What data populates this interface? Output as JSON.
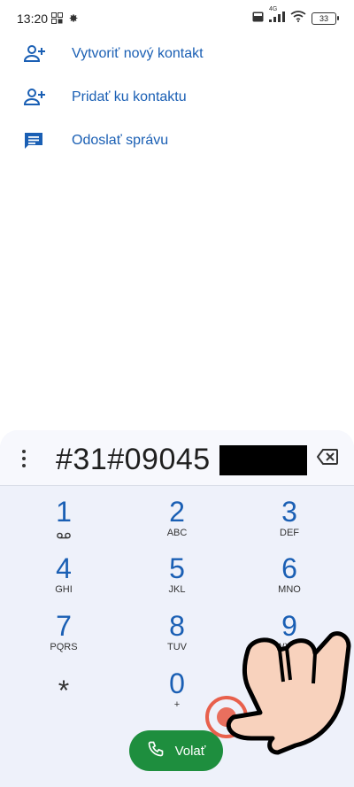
{
  "status_bar": {
    "time": "13:20",
    "network": "4G",
    "battery": "33"
  },
  "actions": [
    {
      "label": "Vytvoriť nový kontakt",
      "icon": "person-add-icon"
    },
    {
      "label": "Pridať ku kontaktu",
      "icon": "person-add-icon"
    },
    {
      "label": "Odoslať správu",
      "icon": "message-icon"
    }
  ],
  "dialer": {
    "number": "#31#09045",
    "keys": [
      {
        "digit": "1",
        "sub": ""
      },
      {
        "digit": "2",
        "sub": "ABC"
      },
      {
        "digit": "3",
        "sub": "DEF"
      },
      {
        "digit": "4",
        "sub": "GHI"
      },
      {
        "digit": "5",
        "sub": "JKL"
      },
      {
        "digit": "6",
        "sub": "MNO"
      },
      {
        "digit": "7",
        "sub": "PQRS"
      },
      {
        "digit": "8",
        "sub": "TUV"
      },
      {
        "digit": "9",
        "sub": "WXYZ"
      },
      {
        "digit": "*",
        "sub": ""
      },
      {
        "digit": "0",
        "sub": "+"
      },
      {
        "digit": "#",
        "sub": ""
      }
    ],
    "call_label": "Volať"
  },
  "colors": {
    "accent": "#1a5fb4",
    "call_green": "#1e8e3e",
    "dialpad_bg": "#eef1fa"
  }
}
